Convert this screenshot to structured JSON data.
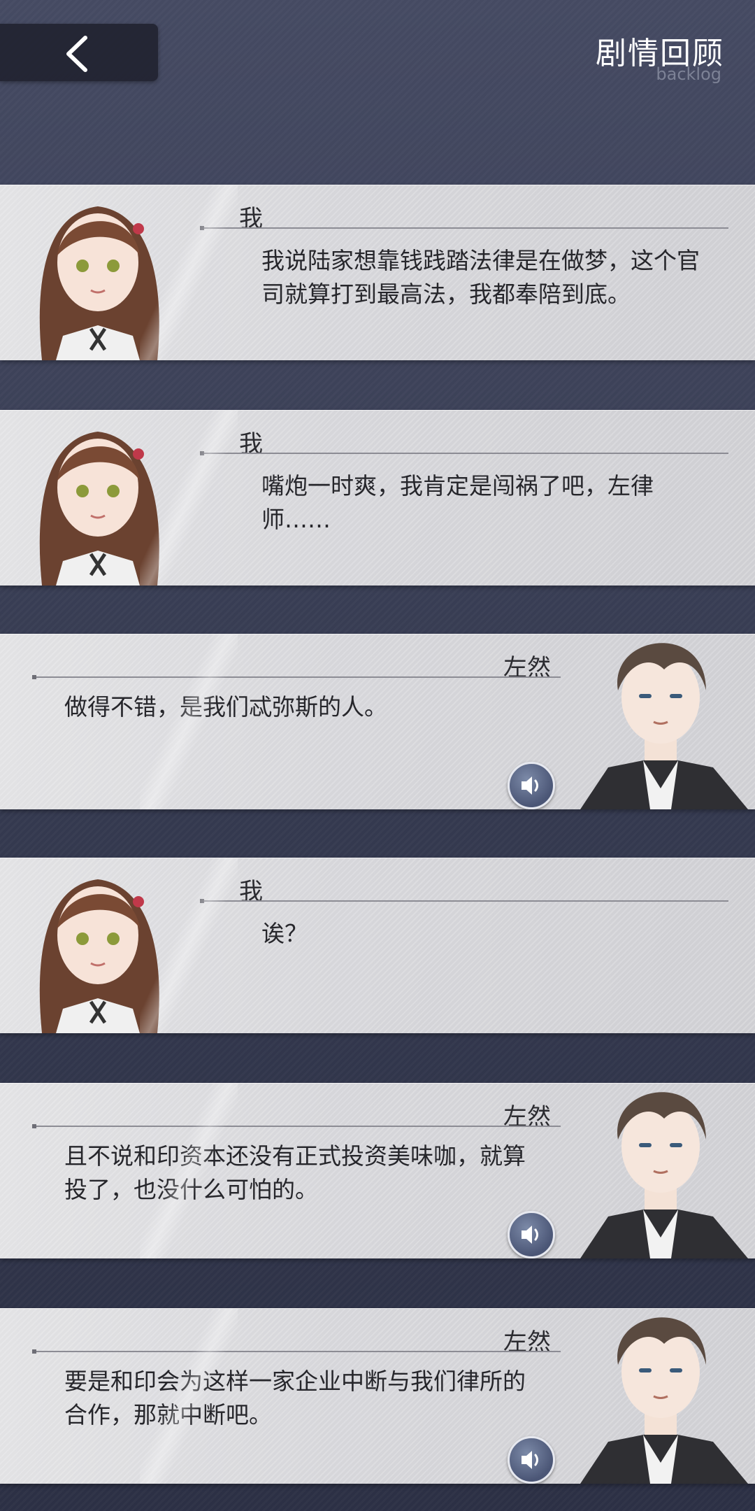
{
  "header": {
    "back_icon": "chevron-left-icon",
    "title": "剧情回顾",
    "subtitle": "backlog"
  },
  "entries": [
    {
      "speaker": "我",
      "text": "我说陆家想靠钱践踏法律是在做梦，这个官司就算打到最高法，我都奉陪到底。"
    },
    {
      "speaker": "我",
      "text": "嘴炮一时爽，我肯定是闯祸了吧，左律师……"
    },
    {
      "speaker": "左然",
      "text": "做得不错，是我们忒弥斯的人。"
    },
    {
      "speaker": "我",
      "text": "诶？"
    },
    {
      "speaker": "左然",
      "text": "且不说和印资本还没有正式投资美味咖，就算投了，也没什么可怕的。"
    },
    {
      "speaker": "左然",
      "text": "要是和印会为这样一家企业中断与我们律所的合作，那就中断吧。"
    }
  ],
  "voice_icon": "speaker-icon",
  "colors": {
    "card": "#d6d6da",
    "background": "#3a3f56",
    "voice_button": "#4b5676"
  }
}
